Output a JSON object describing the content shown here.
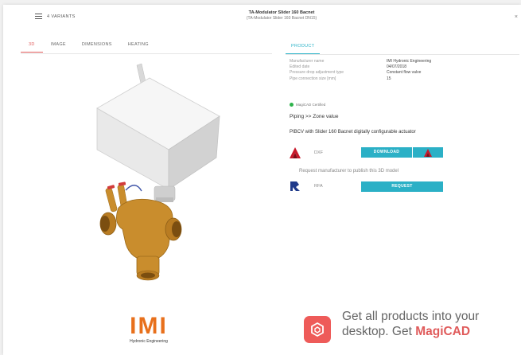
{
  "header": {
    "variants_label": "4 VARIANTS",
    "title": "TA-Modulator Slider 160 Bacnet",
    "subtitle": "(TA-Modulator Slider 160 Bacnet DN15)",
    "close": "×"
  },
  "tabs": [
    {
      "label": "3D"
    },
    {
      "label": "IMAGE"
    },
    {
      "label": "DIMENSIONS"
    },
    {
      "label": "HEATING"
    }
  ],
  "product_tab": "PRODUCT",
  "properties": [
    {
      "key": "Manufacturer name",
      "value": "IMI Hydronic Engineering"
    },
    {
      "key": "Edited date",
      "value": "04/07/2018"
    },
    {
      "key": "Pressure drop adjustment type",
      "value": "Constant flow valve"
    },
    {
      "key": "Pipe connection size [mm]",
      "value": "15"
    }
  ],
  "certified": "MagiCAD Certified",
  "piping": "Piping >> Zone value",
  "description": "PIBCV with Slider 160 Bacnet digitally configurable actuator",
  "download": {
    "format": "DXF",
    "button": "DOWNLOAD"
  },
  "request_note": "Request manufacturer to publish this 3D model",
  "request": {
    "format": "RFA",
    "button": "REQUEST"
  },
  "logo": {
    "name": "IMI",
    "sub": "Hydronic Engineering"
  },
  "promo": {
    "line1": "Get all products into your",
    "line2_prefix": "desktop. Get ",
    "brand": "MagiCAD"
  },
  "colors": {
    "accent": "#2bb0c6",
    "active_tab": "#e05b5b",
    "brand_orange": "#e8701c",
    "magicad_red": "#ee5b59",
    "certified_green": "#2eb34b"
  }
}
